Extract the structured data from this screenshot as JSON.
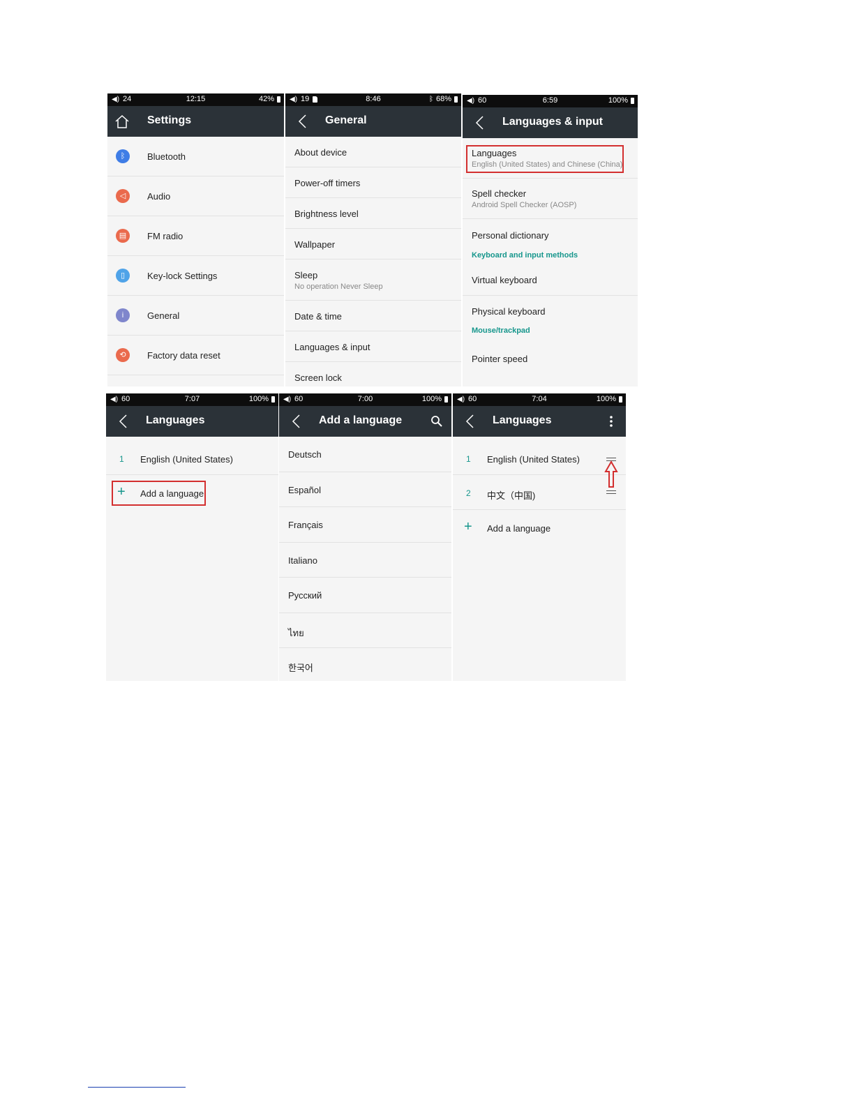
{
  "screens": {
    "settings": {
      "status": {
        "volume": "24",
        "time": "12:15",
        "battery": "42%"
      },
      "title": "Settings",
      "items": [
        {
          "label": "Bluetooth",
          "icon": "bluetooth-icon",
          "color": "#3f7de6",
          "glyph": "ᛒ"
        },
        {
          "label": "Audio",
          "icon": "speaker-icon",
          "color": "#ea6a4d",
          "glyph": "◁"
        },
        {
          "label": "FM radio",
          "icon": "radio-icon",
          "color": "#ea6a4d",
          "glyph": "▤"
        },
        {
          "label": "Key-lock Settings",
          "icon": "keylock-icon",
          "color": "#4fa3e8",
          "glyph": "▯"
        },
        {
          "label": "General",
          "icon": "info-icon",
          "color": "#7f86cc",
          "glyph": "i"
        },
        {
          "label": "Factory data reset",
          "icon": "reset-icon",
          "color": "#ea6a4d",
          "glyph": "⟲"
        }
      ]
    },
    "general": {
      "status": {
        "volume": "19",
        "time": "8:46",
        "battery": "68%"
      },
      "title": "General",
      "items": [
        {
          "label": "About device"
        },
        {
          "label": "Power-off timers"
        },
        {
          "label": "Brightness level"
        },
        {
          "label": "Wallpaper"
        },
        {
          "label": "Sleep",
          "sub": "No operation Never Sleep"
        },
        {
          "label": "Date & time"
        },
        {
          "label": "Languages & input"
        },
        {
          "label": "Screen lock"
        }
      ]
    },
    "languages_input": {
      "status": {
        "volume": "60",
        "time": "6:59",
        "battery": "100%"
      },
      "title": "Languages & input",
      "languages": {
        "label": "Languages",
        "sub": "English (United States) and Chinese (China)"
      },
      "spell": {
        "label": "Spell checker",
        "sub": "Android Spell Checker (AOSP)"
      },
      "personal": "Personal dictionary",
      "kb_header": "Keyboard and input methods",
      "virtual": "Virtual keyboard",
      "physical": "Physical keyboard",
      "mouse_header": "Mouse/trackpad",
      "pointer": "Pointer speed"
    },
    "languages1": {
      "status": {
        "volume": "60",
        "time": "7:07",
        "battery": "100%"
      },
      "title": "Languages",
      "lang1_num": "1",
      "lang1": "English (United States)",
      "add": "Add a language"
    },
    "add_language": {
      "status": {
        "volume": "60",
        "time": "7:00",
        "battery": "100%"
      },
      "title": "Add a language",
      "items": [
        "Deutsch",
        "Español",
        "Français",
        "Italiano",
        "Русский",
        "ไทย",
        "한국어"
      ]
    },
    "languages2": {
      "status": {
        "volume": "60",
        "time": "7:04",
        "battery": "100%"
      },
      "title": "Languages",
      "lang1_num": "1",
      "lang1": "English (United States)",
      "lang2_num": "2",
      "lang2": "中文（中国)",
      "add": "Add a language"
    }
  },
  "colors": {
    "titlebar": "#2b3238",
    "accent": "#16968c",
    "highlight": "#d32f2f"
  }
}
